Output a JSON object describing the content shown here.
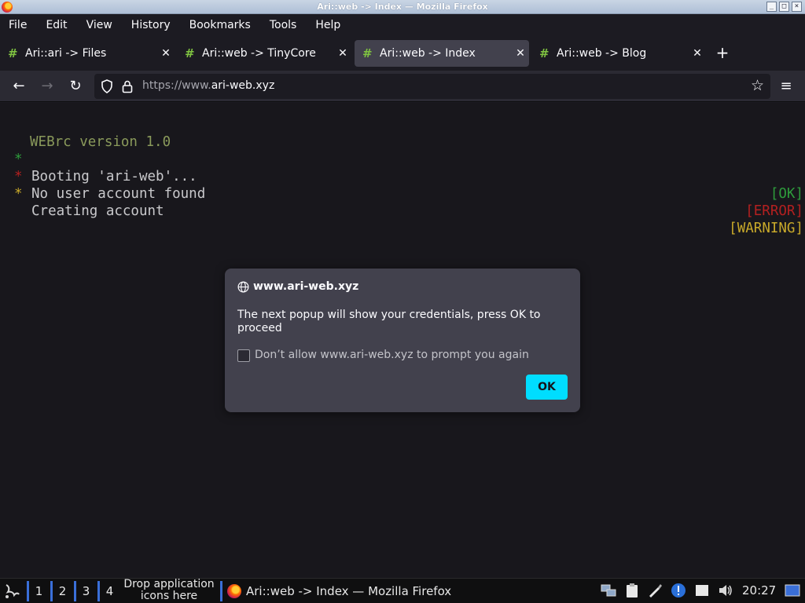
{
  "window": {
    "title": "Ari::web -> Index — Mozilla Firefox"
  },
  "menu": [
    "File",
    "Edit",
    "View",
    "History",
    "Bookmarks",
    "Tools",
    "Help"
  ],
  "tabs": [
    {
      "label": "Ari::ari -> Files",
      "active": false
    },
    {
      "label": "Ari::web -> TinyCore",
      "active": false
    },
    {
      "label": "Ari::web -> Index",
      "active": true
    },
    {
      "label": "Ari::web -> Blog",
      "active": false
    }
  ],
  "address": {
    "prefix": "https://www.",
    "host": "ari-web.xyz"
  },
  "console": {
    "heading": "WEBrc version 1.0",
    "lines": [
      {
        "text": "Booting 'ari-web'...",
        "status": "[OK]",
        "color": "#2e9c3c"
      },
      {
        "text": "No user account found",
        "status": "[ERROR]",
        "color": "#b32020"
      },
      {
        "text": "Creating account",
        "status": "[WARNING]",
        "color": "#c8a92a"
      }
    ]
  },
  "dialog": {
    "site": "www.ari-web.xyz",
    "message": "The next popup will show your credentials, press OK to proceed",
    "checkbox_label": "Don’t allow www.ari-web.xyz to prompt you again",
    "ok_label": "OK"
  },
  "taskbar": {
    "workspaces": [
      "1",
      "2",
      "3",
      "4"
    ],
    "drop_text": "Drop application icons here",
    "task_label": "Ari::web -> Index — Mozilla Firefox",
    "clock": "20:27"
  },
  "colors": {
    "accent": "#00ddff",
    "tab_hash": "#7fc241",
    "heading": "#8a9a5b"
  }
}
